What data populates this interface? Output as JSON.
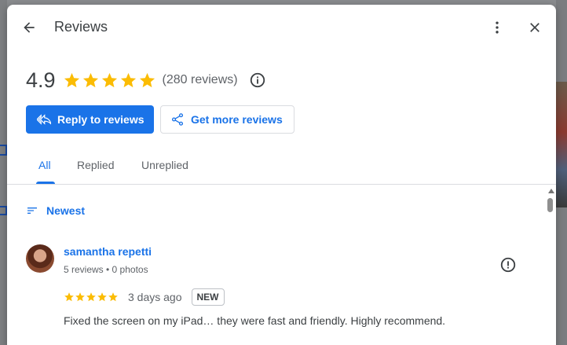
{
  "header": {
    "title": "Reviews",
    "back_icon": "arrow-left-icon",
    "more_icon": "more-vert-icon",
    "close_icon": "close-icon"
  },
  "summary": {
    "rating": "4.9",
    "stars": 5,
    "review_count": "(280 reviews)",
    "info_icon": "info-icon"
  },
  "actions": {
    "reply_label": "Reply to reviews",
    "get_more_label": "Get more reviews"
  },
  "tabs": [
    {
      "label": "All",
      "active": true
    },
    {
      "label": "Replied",
      "active": false
    },
    {
      "label": "Unreplied",
      "active": false
    }
  ],
  "sort": {
    "label": "Newest",
    "icon": "sort-icon"
  },
  "reviews": [
    {
      "author": "samantha repetti",
      "meta": "5 reviews • 0 photos",
      "rating": 5,
      "date": "3 days ago",
      "badge": "NEW",
      "text": "Fixed the screen on my iPad… they were fast and friendly. Highly recommend."
    }
  ],
  "colors": {
    "accent": "#1a73e8",
    "star": "#fbbc04",
    "text_primary": "#3c4043",
    "text_secondary": "#5f6368"
  }
}
